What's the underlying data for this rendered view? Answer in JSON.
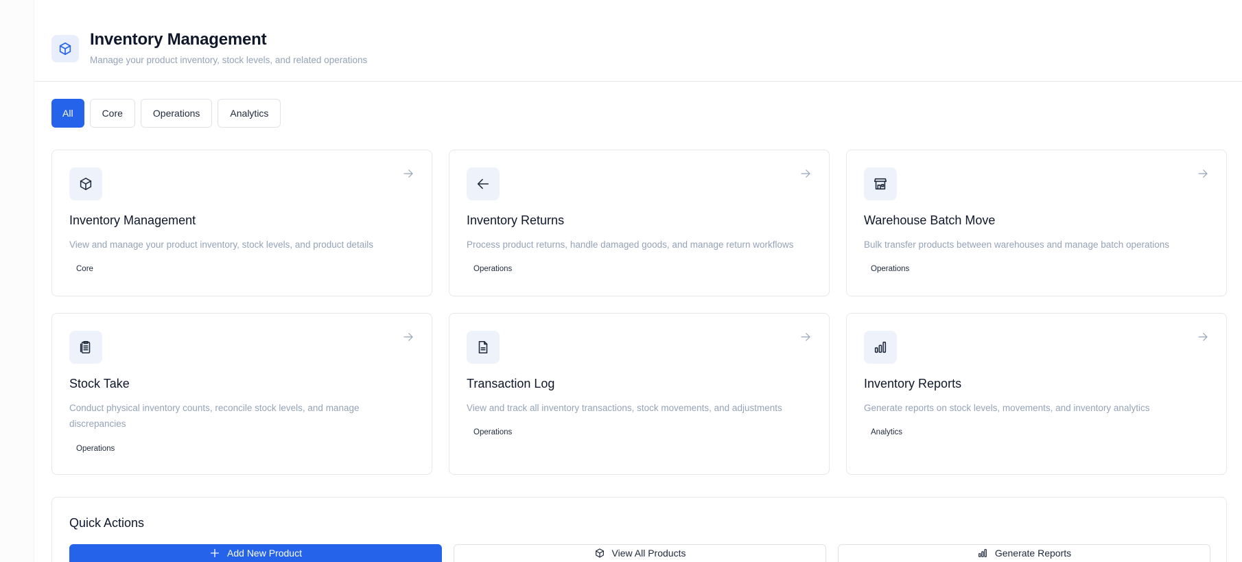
{
  "header": {
    "icon": "package-icon",
    "title": "Inventory Management",
    "subtitle": "Manage your product inventory, stock levels, and related operations"
  },
  "filters": {
    "tabs": [
      {
        "label": "All",
        "active": true
      },
      {
        "label": "Core",
        "active": false
      },
      {
        "label": "Operations",
        "active": false
      },
      {
        "label": "Analytics",
        "active": false
      }
    ]
  },
  "cards": [
    {
      "icon": "package-icon",
      "title": "Inventory Management",
      "description": "View and manage your product inventory, stock levels, and product details",
      "tag": "Core"
    },
    {
      "icon": "arrow-left-icon",
      "title": "Inventory Returns",
      "description": "Process product returns, handle damaged goods, and manage return workflows",
      "tag": "Operations"
    },
    {
      "icon": "warehouse-icon",
      "title": "Warehouse Batch Move",
      "description": "Bulk transfer products between warehouses and manage batch operations",
      "tag": "Operations"
    },
    {
      "icon": "clipboard-icon",
      "title": "Stock Take",
      "description": "Conduct physical inventory counts, reconcile stock levels, and manage discrepancies",
      "tag": "Operations"
    },
    {
      "icon": "file-text-icon",
      "title": "Transaction Log",
      "description": "View and track all inventory transactions, stock movements, and adjustments",
      "tag": "Operations"
    },
    {
      "icon": "bar-chart-icon",
      "title": "Inventory Reports",
      "description": "Generate reports on stock levels, movements, and inventory analytics",
      "tag": "Analytics"
    }
  ],
  "quick_actions": {
    "title": "Quick Actions",
    "buttons": [
      {
        "icon": "plus-icon",
        "label": "Add New Product"
      },
      {
        "icon": "package-icon",
        "label": "View All Products"
      },
      {
        "icon": "bar-chart-icon",
        "label": "Generate Reports"
      }
    ]
  },
  "colors": {
    "accent": "#2563eb",
    "muted_text": "#94a3b8",
    "icon_bg": "#eef2fb",
    "border": "#e5e7eb"
  }
}
